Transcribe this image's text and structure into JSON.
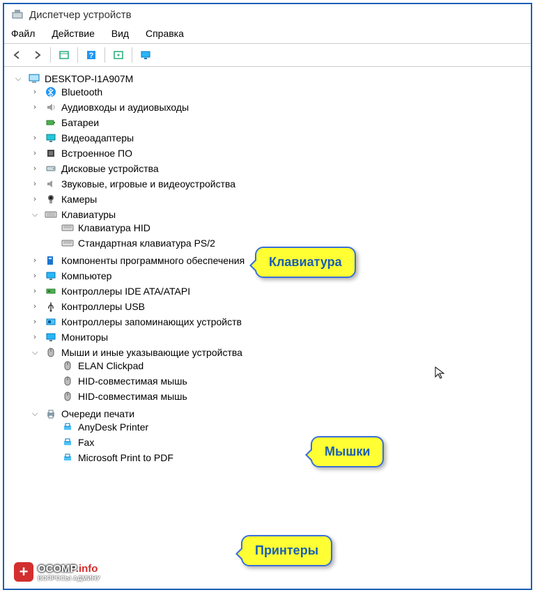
{
  "window": {
    "title": "Диспетчер устройств"
  },
  "menu": {
    "file": "Файл",
    "action": "Действие",
    "view": "Вид",
    "help": "Справка"
  },
  "tree": {
    "root": "DESKTOP-I1A907M",
    "bluetooth": "Bluetooth",
    "audio": "Аудиовходы и аудиовыходы",
    "batteries": "Батареи",
    "video": "Видеоадаптеры",
    "firmware": "Встроенное ПО",
    "disk": "Дисковые устройства",
    "sound": "Звуковые, игровые и видеоустройства",
    "cameras": "Камеры",
    "keyboards": "Клавиатуры",
    "keyboard_hid": "Клавиатура HID",
    "keyboard_ps2": "Стандартная клавиатура PS/2",
    "software": "Компоненты программного обеспечения",
    "computer": "Компьютер",
    "ide": "Контроллеры IDE ATA/ATAPI",
    "usb": "Контроллеры USB",
    "storage": "Контроллеры запоминающих устройств",
    "monitors": "Мониторы",
    "mice": "Мыши и иные указывающие устройства",
    "mouse_elan": "ELAN Clickpad",
    "mouse_hid1": "HID-совместимая мышь",
    "mouse_hid2": "HID-совместимая мышь",
    "printqueue": "Очереди печати",
    "printer_anydesk": "AnyDesk Printer",
    "printer_fax": "Fax",
    "printer_mspdf": "Microsoft Print to PDF"
  },
  "callouts": {
    "keyboard": "Клавиатура",
    "mice": "Мышки",
    "printers": "Принтеры"
  },
  "watermark": {
    "brand": "OCOMP",
    "suffix": ".info",
    "tagline": "ВОПРОСЫ АДМИНУ"
  }
}
